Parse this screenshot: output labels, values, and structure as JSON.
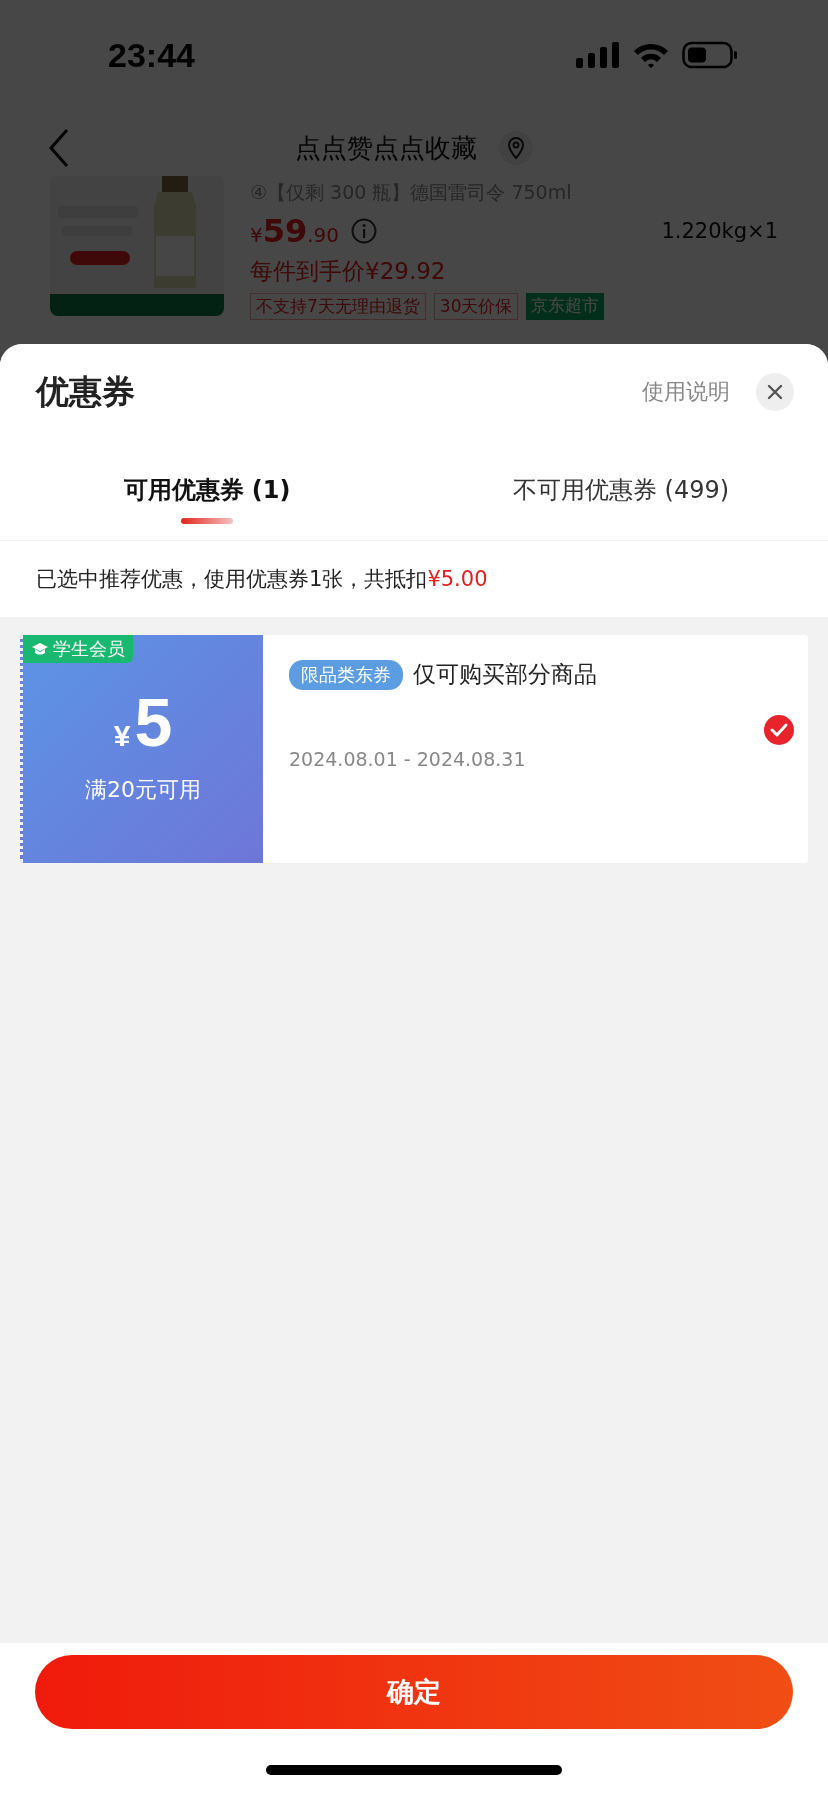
{
  "status_bar": {
    "time": "23:44"
  },
  "nav": {
    "title": "点点赞点点收藏"
  },
  "product": {
    "title": "④【仅剩 300 瓶】德国雷司令 750ml",
    "currency": "¥",
    "price_int": "59",
    "price_dec": ".90",
    "weight": "1.220kg×1",
    "unit_price": "每件到手价¥29.92",
    "tags": [
      {
        "label": "不支持7天无理由退货",
        "kind": "outline"
      },
      {
        "label": "30天价保",
        "kind": "outline"
      },
      {
        "label": "京东超市",
        "kind": "green"
      }
    ]
  },
  "sheet": {
    "title": "优惠券",
    "help": "使用说明",
    "tabs": [
      {
        "label": "可用优惠券 (1)",
        "selected": true
      },
      {
        "label": "不可用优惠券 (499)",
        "selected": false
      }
    ],
    "summary": "已选中推荐优惠，使用优惠券1张，共抵扣",
    "summary_amount": "¥5.00",
    "coupons": [
      {
        "badge": "学生会员",
        "currency": "¥",
        "amount": "5",
        "condition": "满20元可用",
        "tag": "限品类东券",
        "description": "仅可购买部分商品",
        "dates": "2024.08.01 - 2024.08.31",
        "selected": true
      }
    ],
    "confirm": "确定"
  }
}
